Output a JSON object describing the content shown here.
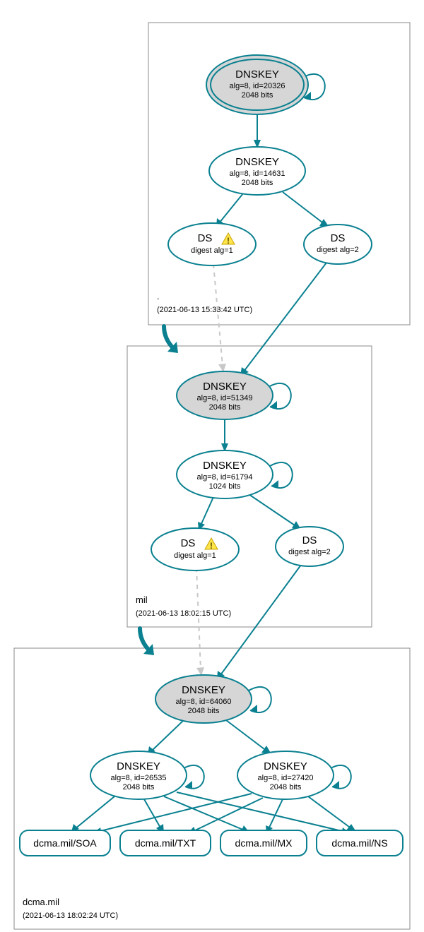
{
  "zones": [
    {
      "name": ".",
      "ts": "(2021-06-13 15:33:42 UTC)"
    },
    {
      "name": "mil",
      "ts": "(2021-06-13 18:02:15 UTC)"
    },
    {
      "name": "dcma.mil",
      "ts": "(2021-06-13 18:02:24 UTC)"
    }
  ],
  "nodes": {
    "rootK1": {
      "title": "DNSKEY",
      "sub1": "alg=8, id=20326",
      "sub2": "2048 bits"
    },
    "rootK2": {
      "title": "DNSKEY",
      "sub1": "alg=8, id=14631",
      "sub2": "2048 bits"
    },
    "rootDS1": {
      "title": "DS",
      "sub": "digest alg=1"
    },
    "rootDS2": {
      "title": "DS",
      "sub": "digest alg=2"
    },
    "milK1": {
      "title": "DNSKEY",
      "sub1": "alg=8, id=51349",
      "sub2": "2048 bits"
    },
    "milK2": {
      "title": "DNSKEY",
      "sub1": "alg=8, id=61794",
      "sub2": "1024 bits"
    },
    "milDS1": {
      "title": "DS",
      "sub": "digest alg=1"
    },
    "milDS2": {
      "title": "DS",
      "sub": "digest alg=2"
    },
    "dcmaK1": {
      "title": "DNSKEY",
      "sub1": "alg=8, id=64060",
      "sub2": "2048 bits"
    },
    "dcmaK2": {
      "title": "DNSKEY",
      "sub1": "alg=8, id=26535",
      "sub2": "2048 bits"
    },
    "dcmaK3": {
      "title": "DNSKEY",
      "sub1": "alg=8, id=27420",
      "sub2": "2048 bits"
    },
    "soa": "dcma.mil/SOA",
    "txt": "dcma.mil/TXT",
    "mx": "dcma.mil/MX",
    "ns": "dcma.mil/NS"
  }
}
